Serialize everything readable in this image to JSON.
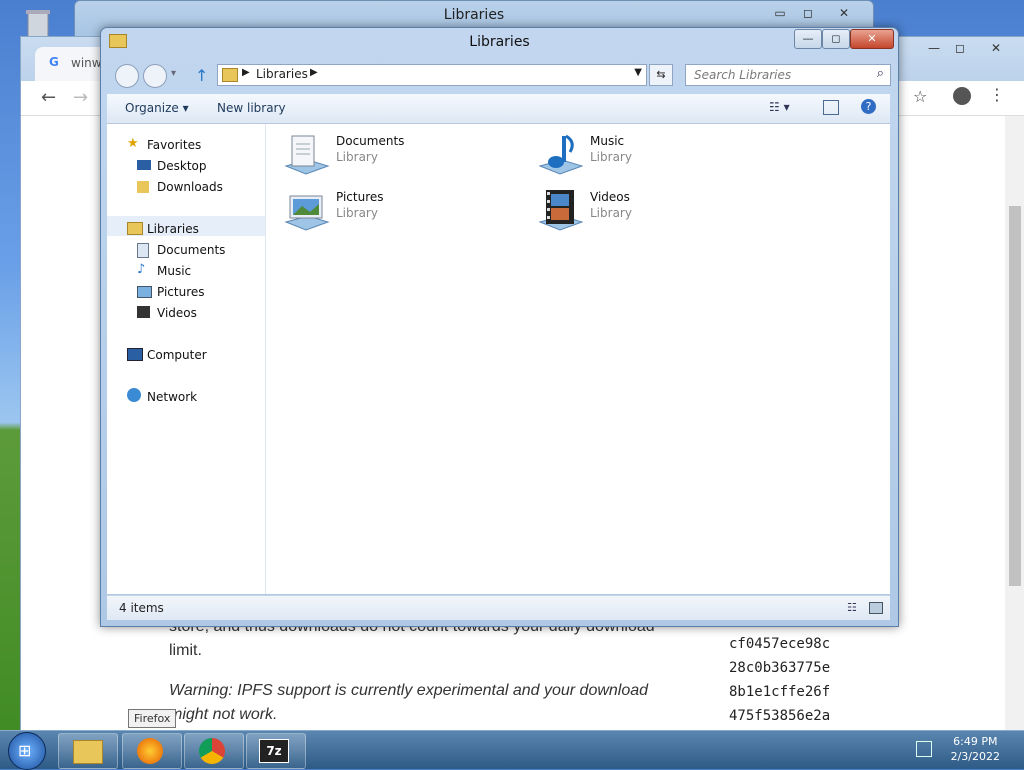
{
  "background_window": {
    "title": "Libraries"
  },
  "chrome": {
    "tab_title": "winw",
    "content": {
      "para1_line1": "store, and thus downloads do not count towards your daily download",
      "para1_line2": "limit.",
      "warning_line1": "Warning: IPFS support is currently experimental and your download",
      "warning_line2": "might not work.",
      "hashes": [
        "cf0457ece98c",
        "28c0b363775e",
        "8b1e1cffe26f",
        "475f53856e2a"
      ]
    }
  },
  "explorer": {
    "title": "Libraries",
    "address": "Libraries",
    "search_placeholder": "Search Libraries",
    "toolbar": {
      "organize": "Organize",
      "new_library": "New library"
    },
    "nav": {
      "favorites": "Favorites",
      "desktop": "Desktop",
      "downloads": "Downloads",
      "libraries": "Libraries",
      "documents": "Documents",
      "music": "Music",
      "pictures": "Pictures",
      "videos": "Videos",
      "computer": "Computer",
      "network": "Network"
    },
    "libraries": [
      {
        "name": "Documents",
        "type": "Library"
      },
      {
        "name": "Music",
        "type": "Library"
      },
      {
        "name": "Pictures",
        "type": "Library"
      },
      {
        "name": "Videos",
        "type": "Library"
      }
    ],
    "status": "4 items"
  },
  "taskbar": {
    "tooltip": "Firefox",
    "time": "6:49 PM",
    "date": "2/3/2022",
    "seven_zip_label": "7z"
  }
}
